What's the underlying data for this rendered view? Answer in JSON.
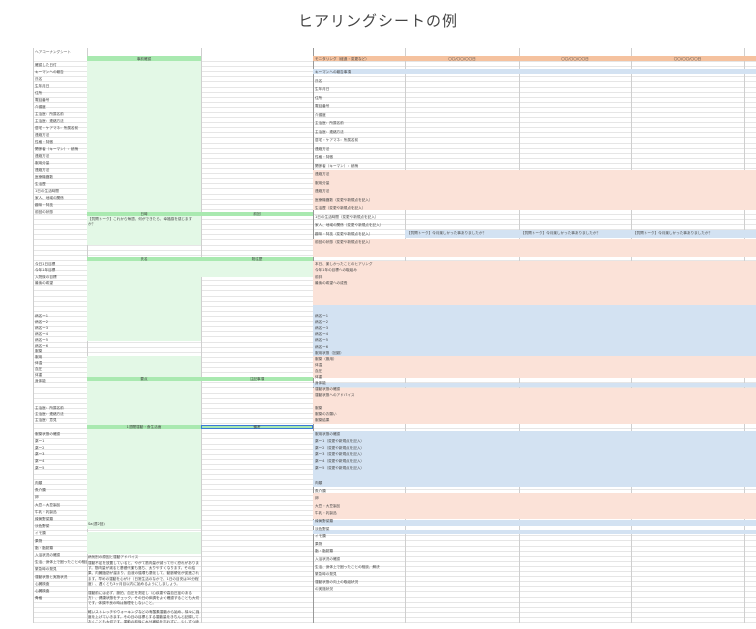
{
  "page_title": "ヒアリングシートの例",
  "left_sheet": {
    "header_label": "ヘアコーナングシート",
    "columns": [
      "事前確認",
      "",
      "日時",
      "前回",
      "氏名",
      "既往歴",
      "要点",
      "注記事項",
      "1週間運動・食生活面",
      "備考"
    ],
    "labels": [
      "確認した日付",
      "キーマンへの報告",
      "氏名",
      "生年月日",
      "住所",
      "電話番号",
      "介護度",
      "主治医：所属名前",
      "主治医：連絡方法",
      "居宅・ケアマネ：所属名前",
      "連絡方法",
      "性格・特徴",
      "関係者（キーマン）：続柄",
      "連絡方法",
      "服用分量",
      "連絡方法",
      "医療機器数",
      "生活歴",
      "1日の生活時間",
      "家人、地域の関係",
      "趣味・特技",
      "前回の状態"
    ],
    "labels2": [
      "今日1日目標",
      "今年1年目標",
      "入院後の目標",
      "最後の希望"
    ],
    "labels3": [
      "病名ー1",
      "病名ー2",
      "病名ー3",
      "病名ー4",
      "病名ー5",
      "病名ー6",
      "服薬",
      "服用",
      "体温",
      "血圧",
      "体重",
      "身体能"
    ],
    "labels4": [
      "主治医：所属名前",
      "主治医：連絡方法",
      "主治医：意見"
    ],
    "labels5": [
      "服薬状態の確認",
      "薬ー1",
      "薬ー2",
      "薬ー3",
      "薬ー4",
      "薬ー5"
    ],
    "labels6": [
      "肉類",
      "魚介類",
      "卵",
      "大豆・大豆製品",
      "牛乳・乳製品",
      "緑黄野菜類",
      "淡色野菜",
      "イモ類",
      "果物",
      "脂・脂肪類",
      "入浴状況の確認",
      "生活、身体上で困ったことの相談、解決",
      "緊急時の発見",
      "運動状態と実施状況",
      "心臓検査",
      "心臓検査",
      "骨格"
    ],
    "hearing_prompt": "【質問トーク】これから毎週、何ができたら、幸福感を感じますか？",
    "bath_value": "Sa(週2回)",
    "advice_title": "病気別の原因と運動アドバイス",
    "advice_1": "運動不足を放置していると、やがて筋肉量が減って行く恐れがあります。筋肉量が減ると基礎代謝も落ち、太りやすくなります。その結果、内臓脂肪が溜まり、血液の循環も悪化して、動脈硬化が促進されます。早めの運動を心がけ（日常生活のなかで、1日の目安は30分程度）、遅くとも3ヶ月目以内に始めるようにしましょう。",
    "advice_2": "運動前には必ず、脈拍、血圧を測定し（心疾患や高血圧症のある方）、健康状態をチェック。その日の体調をよく確認することも大切です。体調不良の時は無理をしないこと。",
    "advice_3": "軽いストレッチやウォーキングなどの有酸素運動から始め、徐々に強度を上げていきます。その日の目標とする運動量をきちんと記録しておくことも大切です。運動の前後に水分補給を忘れずに、少しずつ続けることが大切です。"
  },
  "right_sheet": {
    "header_label": "モニタリング（経過・変更など）",
    "date_headers": [
      "〇〇/〇〇/〇〇日",
      "〇〇/〇〇/〇〇日",
      "〇〇/〇〇/〇〇日"
    ],
    "labels": [
      "キーマンへの報告事項",
      "氏名",
      "生年月日",
      "住所",
      "電話番号",
      "介護度",
      "主治医：所属名前",
      "主治医：連絡方法",
      "居宅・ケアマネ：所属名前",
      "連絡方法",
      "性格・特徴",
      "関係者（キーマン）：続柄",
      "連絡方法",
      "服用分量",
      "連絡方法",
      "医療機器数（変更や新規点を記入）",
      "生活歴（変更や新規点を記入）",
      "1日の生活時間（変更や新規点を記入）",
      "家人、地域の関係（変更や新規点を記入）",
      "趣味・特技（変更や新規点を記入）",
      "前回の状態（変更や新規点を記入）"
    ],
    "question": "【質問トーク】今月楽しかった事ありましたか？",
    "labels2": [
      "本日、楽しかったことのヒアリング",
      "今年1年の目標への取組み",
      "前評",
      "最後の希望への成長"
    ],
    "labels3": [
      "病名ー1",
      "病名ー2",
      "病名ー3",
      "病名ー4",
      "病名ー5",
      "病名ー6",
      "服用状態（回避）",
      "服薬（服用）",
      "体温",
      "血圧",
      "体重",
      "身体能",
      "運動状態の確認",
      "運動状態へのアドバイス"
    ],
    "labels4": [
      "服薬",
      "服薬のお願い",
      "服薬結果"
    ],
    "labels5": [
      "服用状態の確認",
      "薬ー1（変更や新規点を記入）",
      "薬ー2（変更や新規点を記入）",
      "薬ー3（変更や新規点を記入）",
      "薬ー4（変更や新規点を記入）",
      "薬ー5（変更や新規点を記入）"
    ],
    "labels6": [
      "肉類",
      "魚介類",
      "卵",
      "大豆・大豆製品",
      "牛乳・乳製品",
      "緑黄野菜類",
      "淡色野菜",
      "イモ類",
      "果物",
      "脂・脂肪類",
      "入浴状況の確認",
      "生活、身体上で困ったことの相談、解決",
      "緊急時の発見",
      "運動状態の向上の取組状況",
      "の実施状況"
    ]
  }
}
